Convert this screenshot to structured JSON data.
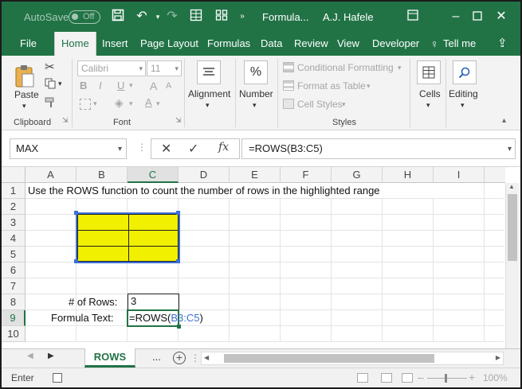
{
  "titlebar": {
    "autosave_label": "AutoSave",
    "autosave_state": "Off",
    "doc_title": "Formula...",
    "user": "A.J. Hafele"
  },
  "tabs": [
    "File",
    "Home",
    "Insert",
    "Page Layout",
    "Formulas",
    "Data",
    "Review",
    "View",
    "Developer"
  ],
  "tell_me": "Tell me",
  "ribbon": {
    "clipboard": {
      "paste": "Paste",
      "label": "Clipboard"
    },
    "font": {
      "name": "Calibri",
      "size": "11",
      "label": "Font",
      "bold": "B",
      "italic": "I",
      "underline": "U",
      "grow": "A",
      "shrink": "A"
    },
    "alignment": {
      "label": "Alignment"
    },
    "number": {
      "label": "Number",
      "icon_text": "%"
    },
    "styles": {
      "conditional": "Conditional Formatting",
      "format_table": "Format as Table",
      "cell_styles": "Cell Styles",
      "label": "Styles"
    },
    "cells": {
      "label": "Cells"
    },
    "editing": {
      "label": "Editing"
    }
  },
  "formula_bar": {
    "name_box": "MAX",
    "fx": "fx",
    "formula": "=ROWS(B3:C5)"
  },
  "columns": [
    "A",
    "B",
    "C",
    "D",
    "E",
    "F",
    "G",
    "H",
    "I"
  ],
  "rows": [
    "1",
    "2",
    "3",
    "4",
    "5",
    "6",
    "7",
    "8",
    "9",
    "10"
  ],
  "cells": {
    "a1": "Use the ROWS function to count the number of rows in the highlighted range",
    "b8": "# of Rows:",
    "c8": "3",
    "b9": "Formula Text:",
    "c9_prefix": "=ROWS(",
    "c9_ref": "B3:C5",
    "c9_suffix": ")"
  },
  "sheet_tab": "ROWS",
  "sheet_more": "...",
  "status": {
    "mode": "Enter",
    "zoom": "100%"
  },
  "colors": {
    "brand": "#217346",
    "highlight": "#f0f000",
    "range_ref": "#3b6fd6"
  }
}
